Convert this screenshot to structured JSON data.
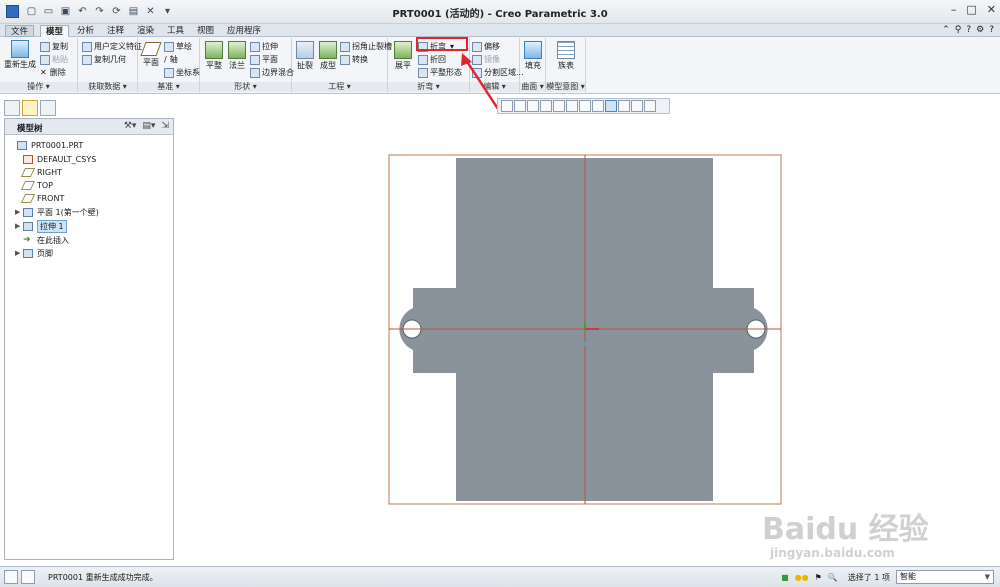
{
  "window": {
    "title": "PRT0001 (活动的) - Creo Parametric 3.0",
    "quick_access": [
      "new-icon",
      "open-icon",
      "save-icon",
      "undo-icon",
      "redo-icon",
      "regenerate-icon",
      "windows-icon",
      "close-window-icon",
      "customize-icon"
    ],
    "controls": [
      "minimize-icon",
      "maximize-icon",
      "close-icon"
    ]
  },
  "tabs": {
    "file": "文件",
    "items": [
      "模型",
      "分析",
      "注释",
      "渲染",
      "工具",
      "视图",
      "应用程序"
    ],
    "active": "模型"
  },
  "ribbon": {
    "groups": {
      "operations": {
        "label": "操作 ▾",
        "regenerate": "重新生成",
        "copy": "复制",
        "paste": "粘贴",
        "delete": "删除"
      },
      "get_data": {
        "label": "获取数据 ▾",
        "udf": "用户定义特征",
        "copy_geometry": "复制几何"
      },
      "datum": {
        "label": "基准 ▾",
        "plane": "平面",
        "sketch": "草绘",
        "axis": "轴",
        "csys": "坐标系"
      },
      "shapes": {
        "label": "形状 ▾",
        "flat": "平整",
        "flange": "法兰",
        "extrude": "拉伸",
        "planar": "平面",
        "boundary_blend": "边界混合"
      },
      "engineering": {
        "label": "工程 ▾",
        "rip": "扯裂",
        "form": "成型",
        "corner_relief": "拐角止裂槽",
        "convert": "转换"
      },
      "bends": {
        "label": "折弯 ▾",
        "unbend": "展平",
        "bend": "折弯",
        "bend_back": "折回",
        "flat_state": "平整形态"
      },
      "editing": {
        "label": "编辑 ▾",
        "offset": "偏移",
        "mirror": "镜像",
        "split_area": "分割区域..."
      },
      "surfaces": {
        "label": "曲面 ▾",
        "fill": "填充"
      },
      "model_intent": {
        "label": "模型意图 ▾",
        "table": "族表"
      }
    }
  },
  "view_toolbar": {
    "buttons": [
      "refit-icon",
      "zoom-in-icon",
      "zoom-out-icon",
      "repaint-icon",
      "sketch-view-icon",
      "saved-views-icon",
      "display-style-icon",
      "datum-display-icon",
      "plane-display-icon",
      "annotation-display-icon",
      "spin-center-icon",
      "appearance-icon"
    ]
  },
  "model_tree": {
    "title": "模型树",
    "items": [
      {
        "label": "PRT0001.PRT",
        "icon": "part-icon",
        "expander": ""
      },
      {
        "label": "DEFAULT_CSYS",
        "icon": "csys-icon",
        "expander": ""
      },
      {
        "label": "RIGHT",
        "icon": "datum-plane-icon",
        "expander": ""
      },
      {
        "label": "TOP",
        "icon": "datum-plane-icon",
        "expander": ""
      },
      {
        "label": "FRONT",
        "icon": "datum-plane-icon",
        "expander": ""
      },
      {
        "label": "平面 1(第一个壁)",
        "icon": "planar-wall-icon",
        "expander": "▶"
      },
      {
        "label": "拉伸 1",
        "icon": "extrude-icon",
        "expander": "▶",
        "selected": true
      },
      {
        "label": "在此插入",
        "icon": "insert-here-icon",
        "expander": ""
      },
      {
        "label": "页脚",
        "icon": "footer-icon",
        "expander": "▶"
      }
    ]
  },
  "status": {
    "message": "PRT0001 重新生成成功完成。",
    "selection": "选择了 1 项",
    "filter": "智能"
  },
  "colors": {
    "part_fill": "#8a929b",
    "datum_line": "#b25a32",
    "highlight": "#e0262c",
    "tree_selected": "#cde3f7"
  },
  "watermark": {
    "main": "Baidu 经验",
    "sub": "jingyan.baidu.com"
  }
}
